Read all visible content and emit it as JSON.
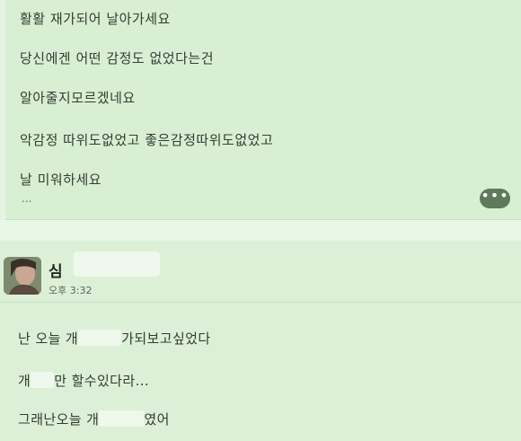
{
  "post": {
    "lines": [
      "활활 재가되어 날아가세요",
      "당신에겐 어떤 감정도 없었다는건",
      "알아줄지모르겠네요",
      "악감정 따위도없었고 좋은감정따위도없었고",
      "날 미워하세요"
    ],
    "ellipsis": "...",
    "more_label": "•••"
  },
  "comment": {
    "author_initial": "심",
    "time": "오후 3:32",
    "line1": {
      "before": "난 오늘 개",
      "after": "가되보고싶었다"
    },
    "line2": {
      "before": "개",
      "after": "만 할수있다라..."
    },
    "line3": {
      "before": "그래난오늘 개",
      "after": "였어"
    }
  },
  "colors": {
    "background": "#e6f5e3",
    "card": "#d9efd3",
    "more_button": "#5d7a5a",
    "redaction": "#eef8ec"
  }
}
